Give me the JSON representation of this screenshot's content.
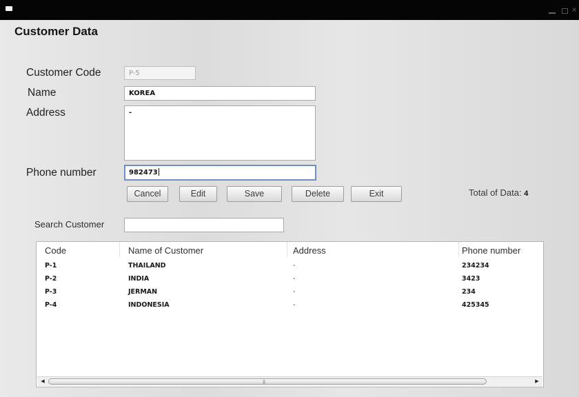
{
  "window": {
    "title": "Customer Data"
  },
  "form": {
    "code_label": "Customer Code",
    "code_value": "P-5",
    "name_label": "Name",
    "name_value": "KOREA",
    "address_label": "Address",
    "address_value": "-",
    "phone_label": "Phone number",
    "phone_value": "982473"
  },
  "buttons": {
    "cancel": "Cancel",
    "edit": "Edit",
    "save": "Save",
    "delete": "Delete",
    "exit": "Exit"
  },
  "total": {
    "label": "Total of Data:",
    "value": "4"
  },
  "search": {
    "label": "Search Customer",
    "value": ""
  },
  "table": {
    "columns": [
      "Code",
      "Name of Customer",
      "Address",
      "Phone number"
    ],
    "rows": [
      [
        "P-1",
        "THAILAND",
        "-",
        "234234"
      ],
      [
        "P-2",
        "INDIA",
        "-",
        "3423"
      ],
      [
        "P-3",
        "JERMAN",
        "-",
        "234"
      ],
      [
        "P-4",
        "INDONESIA",
        "-",
        "425345"
      ]
    ]
  },
  "icons": {
    "scroll_left": "scroll-left-arrow-icon",
    "scroll_right": "scroll-right-arrow-icon"
  },
  "colors": {
    "focus_border": "#6e8fc2",
    "titlebar": "#050505"
  }
}
